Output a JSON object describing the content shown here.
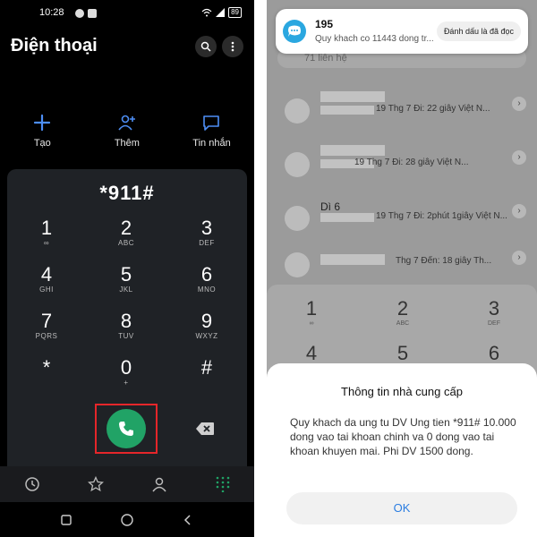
{
  "left": {
    "status": {
      "time": "10:28",
      "battery": "89"
    },
    "title": "Điện thoại",
    "actions": [
      {
        "label": "Tạo",
        "icon": "plus-icon"
      },
      {
        "label": "Thêm",
        "icon": "add-person-icon"
      },
      {
        "label": "Tin nhắn",
        "icon": "message-icon"
      }
    ],
    "entered_number": "*911#",
    "keys": [
      {
        "digit": "1",
        "sub": "∞"
      },
      {
        "digit": "2",
        "sub": "ABC"
      },
      {
        "digit": "3",
        "sub": "DEF"
      },
      {
        "digit": "4",
        "sub": "GHI"
      },
      {
        "digit": "5",
        "sub": "JKL"
      },
      {
        "digit": "6",
        "sub": "MNO"
      },
      {
        "digit": "7",
        "sub": "PQRS"
      },
      {
        "digit": "8",
        "sub": "TUV"
      },
      {
        "digit": "9",
        "sub": "WXYZ"
      },
      {
        "digit": "*",
        "sub": ""
      },
      {
        "digit": "0",
        "sub": "+"
      },
      {
        "digit": "#",
        "sub": ""
      }
    ],
    "accent_call": "#21a366",
    "highlight": "#e5262a"
  },
  "right": {
    "notification": {
      "sender": "195",
      "preview": "Quy khach co 11443 dong tr...",
      "action": "Đánh dấu là đã đọc"
    },
    "search_placeholder": "71 liên hệ",
    "contacts": [
      {
        "name": "",
        "meta": "19 Thg 7 Đi: 22 giây Việt N..."
      },
      {
        "name": "",
        "meta": "19 Thg 7 Đi: 28 giây Việt N..."
      },
      {
        "name": "Dì 6",
        "meta": "19 Thg 7 Đi: 2phút 1giây Việt N..."
      },
      {
        "name": "",
        "meta": "Thg 7 Đến: 18 giây Th..."
      }
    ],
    "keypad_preview": [
      {
        "digit": "1",
        "sub": "∞"
      },
      {
        "digit": "2",
        "sub": "ABC"
      },
      {
        "digit": "3",
        "sub": "DEF"
      },
      {
        "digit": "4",
        "sub": ""
      },
      {
        "digit": "5",
        "sub": ""
      },
      {
        "digit": "6",
        "sub": ""
      }
    ],
    "dialog": {
      "title": "Thông tin nhà cung cấp",
      "body": "Quy khach da ung tu DV Ung tien *911# 10.000 dong vao tai khoan chinh va 0 dong vao tai khoan khuyen mai. Phi DV 1500 dong.",
      "ok": "OK"
    }
  }
}
